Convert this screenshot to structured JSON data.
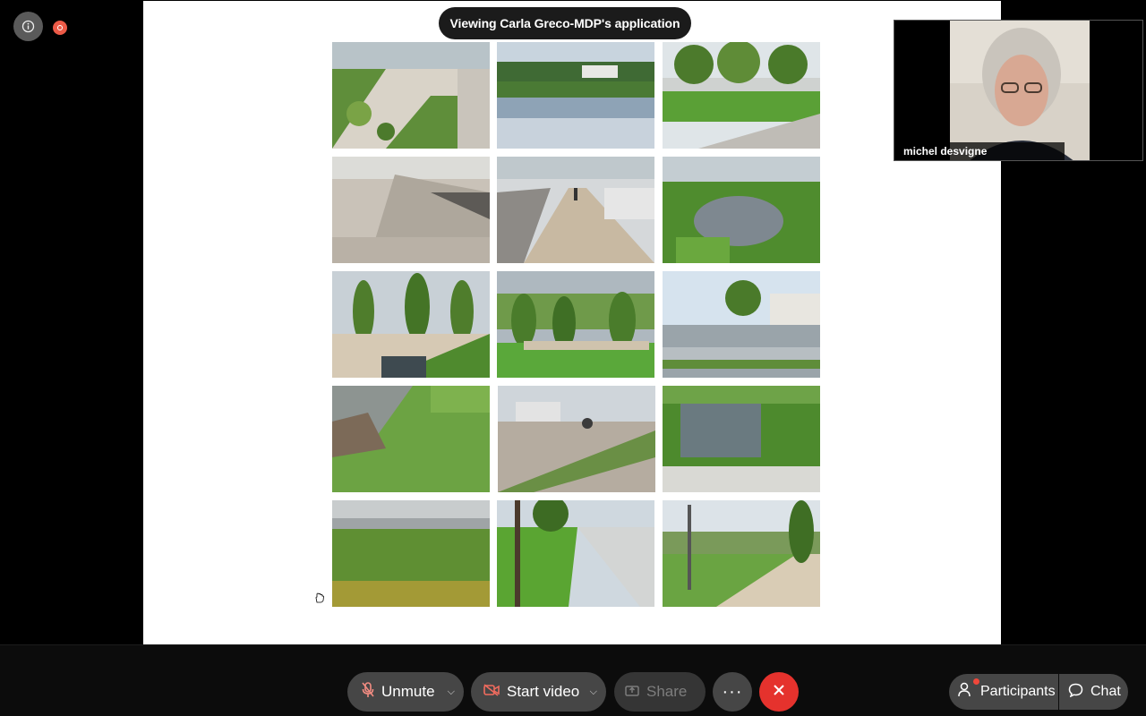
{
  "banner": {
    "text": "Viewing Carla Greco-MDP's application"
  },
  "video": {
    "participant_name": "michel desvigne"
  },
  "toolbar": {
    "unmute_label": "Unmute",
    "start_video_label": "Start video",
    "share_label": "Share",
    "more_label": "···",
    "participants_label": "Participants",
    "chat_label": "Chat"
  },
  "colors": {
    "leave_red": "#e5322d",
    "recording_dot": "#ec5a47",
    "mute_icon": "#f28c82",
    "video_off_icon": "#f06b5e"
  },
  "icons": {
    "info": "info-icon",
    "record": "recording-icon",
    "mic_off": "mic-off-icon",
    "video_off": "video-off-icon",
    "share": "share-icon",
    "more": "more-icon",
    "leave": "close-icon",
    "participants": "person-icon",
    "chat": "chat-icon",
    "cursor": "hand-cursor-icon"
  }
}
